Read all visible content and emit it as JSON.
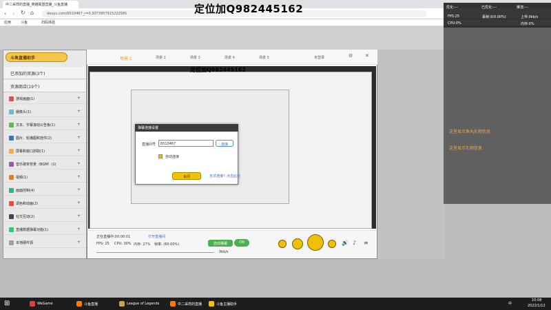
{
  "browser": {
    "tab_title": "中二采样的直播_英雄联盟直播_斗鱼直播",
    "url": "douyu.com/6510467_r=0.3073957915222585",
    "bookmarks": [
      "应用",
      "斗鱼",
      "扫码体验"
    ]
  },
  "watermark_top": "定位加Q982445162",
  "watermark_mid": "定位加Q982445162",
  "perf_overlay": {
    "h1": "优化:---",
    "h2": "已优化:---",
    "h3": "推流:---",
    "fps": "FPS:25",
    "drop": "丢帧:0(0.00%)",
    "up": "上传:0kb/s",
    "cpu": "CPU:0%",
    "mem": "内存:0%"
  },
  "assistant": {
    "logo": "斗鱼直播助手",
    "tabs": [
      "场景 1",
      "场景 2",
      "场景 3",
      "场景 4",
      "场景 5"
    ],
    "user": "未登录",
    "section_added": "已添加的资源(3个)",
    "section_store": "资源商店(19个)",
    "categories": [
      {
        "label": "游戏画面(1)",
        "color": "#d9534f"
      },
      {
        "label": "摄像头(1)",
        "color": "#5bc0de"
      },
      {
        "label": "文本、字幕滚动公告板(1)",
        "color": "#5cb85c"
      },
      {
        "label": "图片、轮播图和挂件(2)",
        "color": "#337ab7"
      },
      {
        "label": "屏幕和窗口抓取(1)",
        "color": "#f0ad4e"
      },
      {
        "label": "音乐歌单背景（BGM）(1)",
        "color": "#9b59b6"
      },
      {
        "label": "视频(1)",
        "color": "#e67e22"
      },
      {
        "label": "画面控制(4)",
        "color": "#1abc9c"
      },
      {
        "label": "调色和动画(2)",
        "color": "#e74c3c"
      },
      {
        "label": "社交互动(2)",
        "color": "#34495e"
      },
      {
        "label": "直播数据弹幕功能(1)",
        "color": "#2ecc71"
      },
      {
        "label": "本地硬件源",
        "color": "#95a5a6"
      }
    ],
    "status": {
      "live_text": "正在直播中:00:00:01",
      "link": "打开直播间",
      "fps": "FPS: 25",
      "cpu": "CPU: 30%",
      "mem": "内存: 27%",
      "bandwidth": "帧率: (60.00%)",
      "toggle": "自动弹幕",
      "on": "ON",
      "upload": "0kb/s"
    }
  },
  "dialog": {
    "title": "弹幕连接设置",
    "room_label": "直播间号",
    "room_value": "6510467",
    "connect_btn": "连接",
    "auto_label": "自动连接",
    "close_btn": "关闭",
    "help_link": "无法连接？点击此处"
  },
  "right_panel": {
    "gift1": "这里显示鱼丸礼物信息",
    "gift2": "这里显示礼物信息"
  },
  "taskbar": {
    "items": [
      {
        "label": "WeGame",
        "color": "#e63e3e"
      },
      {
        "label": "斗鱼直播",
        "color": "#ff7a00"
      },
      {
        "label": "League of Legends",
        "color": "#c8a450"
      },
      {
        "label": "中二采样的直播",
        "color": "#ff7a00"
      },
      {
        "label": "斗鱼主播助手",
        "color": "#f5c400"
      }
    ],
    "time": "10:08",
    "date": "2022/1/12",
    "lang": "中"
  }
}
